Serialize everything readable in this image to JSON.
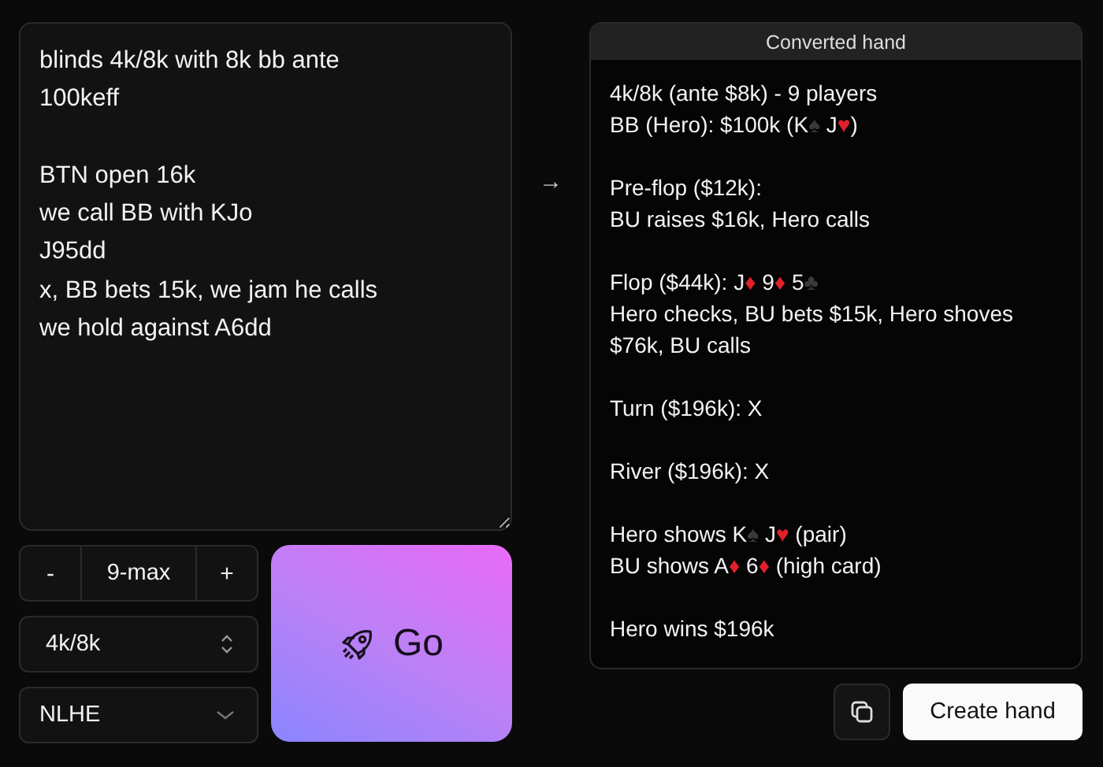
{
  "input": {
    "paragraphs": [
      [
        "blinds 4k/8k with 8k bb ante",
        "100keff"
      ],
      [
        "BTN open 16k",
        "we call BB with KJo",
        "J95dd",
        "x, BB bets 15k, we jam he calls",
        "we hold against A6dd"
      ]
    ]
  },
  "arrow": "→",
  "controls": {
    "stepper": {
      "minus": "-",
      "value": "9-max",
      "plus": "+"
    },
    "stakes": "4k/8k",
    "game": "NLHE"
  },
  "go_button": {
    "label": "Go"
  },
  "output": {
    "title": "Converted hand",
    "paragraphs": [
      [
        "4k/8k (ante $8k) - 9 players",
        "BB (Hero): $100k (K♠ J♥)"
      ],
      [
        "Pre-flop ($12k):",
        "BU raises $16k, Hero calls"
      ],
      [
        "Flop ($44k): J♦ 9♦ 5♣",
        "Hero checks, BU bets $15k, Hero shoves $76k, BU calls"
      ],
      [
        "Turn ($196k): X"
      ],
      [
        "River ($196k): X"
      ],
      [
        "Hero shows K♠ J♥ (pair)",
        "BU shows A♦ 6♦ (high card)"
      ],
      [
        "Hero wins $196k"
      ]
    ]
  },
  "actions": {
    "create_button": "Create hand"
  }
}
